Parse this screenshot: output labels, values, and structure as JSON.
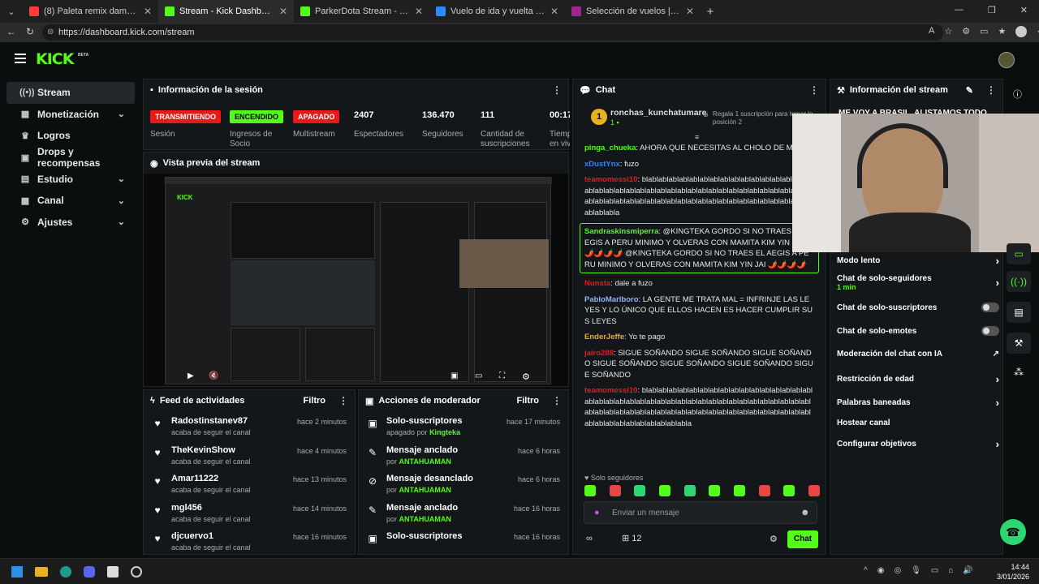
{
  "browser": {
    "tabs": [
      {
        "title": "(8) Paleta remix dame paleta palet",
        "color": "#ff3b3b"
      },
      {
        "title": "Stream - Kick Dashboard",
        "color": "#53fc18",
        "active": true
      },
      {
        "title": "ParkerDota Stream - Watch Live o",
        "color": "#53fc18"
      },
      {
        "title": "Vuelo de ida y vuelta a Fortaleza |",
        "color": "#2a8bff"
      },
      {
        "title": "Selección de vuelos | LATAM Airlin",
        "color": "#a0258f"
      }
    ],
    "url": "https://dashboard.kick.com/stream"
  },
  "header": {
    "logo": "KICK",
    "logo_beta": "BETA"
  },
  "sidebar": {
    "items": [
      {
        "label": "Stream",
        "icon": "broadcast-icon",
        "active": true
      },
      {
        "label": "Monetización",
        "icon": "money-icon",
        "chevron": true
      },
      {
        "label": "Logros",
        "icon": "trophy-icon"
      },
      {
        "label": "Drops y recompensas",
        "icon": "gift-icon"
      },
      {
        "label": "Estudio",
        "icon": "studio-icon",
        "chevron": true
      },
      {
        "label": "Canal",
        "icon": "user-icon",
        "chevron": true
      },
      {
        "label": "Ajustes",
        "icon": "gear-icon",
        "chevron": true
      }
    ]
  },
  "session": {
    "title": "Información de la sesión",
    "stats": [
      {
        "badge": "TRANSMITIENDO",
        "badge_color": "#e91916",
        "label": "Sesión"
      },
      {
        "badge": "ENCENDIDO",
        "badge_color": "#53fc18",
        "label": "Ingresos de Socio"
      },
      {
        "badge": "APAGADO",
        "badge_color": "#e91916",
        "label": "Multistream"
      },
      {
        "value": "2407",
        "label": "Espectadores"
      },
      {
        "value": "136.470",
        "label": "Seguidores"
      },
      {
        "value": "111",
        "label": "Cantidad de suscripciones"
      },
      {
        "value": "00:17",
        "label": "Tiempo en vivo"
      }
    ]
  },
  "preview": {
    "title": "Vista previa del stream"
  },
  "feed": {
    "title": "Feed de actividades",
    "filter": "Filtro",
    "rows": [
      {
        "user": "Radostinstanev87",
        "action": "acaba de seguir el canal",
        "time": "hace 2 minutos"
      },
      {
        "user": "TheKevinShow",
        "action": "acaba de seguir el canal",
        "time": "hace 4 minutos"
      },
      {
        "user": "Amar11222",
        "action": "acaba de seguir el canal",
        "time": "hace 13 minutos"
      },
      {
        "user": "mgl456",
        "action": "acaba de seguir el canal",
        "time": "hace 14 minutos"
      },
      {
        "user": "djcuervo1",
        "action": "acaba de seguir el canal",
        "time": "hace 16 minutos"
      }
    ]
  },
  "modactions": {
    "title": "Acciones de moderador",
    "filter": "Filtro",
    "rows": [
      {
        "action": "Solo-suscriptores",
        "sub_prefix": "apagado por",
        "by": "Kingteka",
        "time": "hace 17 minutos",
        "icon": "gift-icon"
      },
      {
        "action": "Mensaje anclado",
        "sub_prefix": "por",
        "by": "ANTAHUAMAN",
        "time": "hace 6 horas",
        "icon": "pin-icon"
      },
      {
        "action": "Mensaje desanclado",
        "sub_prefix": "por",
        "by": "ANTAHUAMAN",
        "time": "hace 6 horas",
        "icon": "unpin-icon"
      },
      {
        "action": "Mensaje anclado",
        "sub_prefix": "por",
        "by": "ANTAHUAMAN",
        "time": "hace 16 horas",
        "icon": "pin-icon"
      },
      {
        "action": "Solo-suscriptores",
        "sub_prefix": "",
        "by": "",
        "time": "hace 16 horas",
        "icon": "gift-icon"
      }
    ]
  },
  "chat": {
    "title": "Chat",
    "pinned_user": "ronchas_kunchatumare",
    "pinned_level": "1",
    "gift_text": "Regala 1 suscripción para tomar la posición 2",
    "messages": [
      {
        "user": "pinga_chueka",
        "color": "#53fc18",
        "text": "AHORA QUE NECESITAS AL CHOLO DE MRD"
      },
      {
        "user": "xDustYnx",
        "color": "#3b82f6",
        "text": "fuzo"
      },
      {
        "user": "teamomessi10",
        "color": "#e91916",
        "text": "blablablablablablablablablablablablablablablablablablablablablablablablablablablablablablablablablablablablablablablablablablablablablablablablablablablablablablablablablablablablablablablabla"
      },
      {
        "user": "Sandraskinsmiperra",
        "color": "#53fc18",
        "highlight": true,
        "text": "@KINGTEKA GORDO SI NO TRAES EL AEGIS A PERU MINIMO Y OLVERAS CON MAMITA KIM YIN JAI 🌶️🌶️🌶️🌶️ @KINGTEKA GORDO SI NO TRAES EL AEGIS A PERU MINIMO Y OLVERAS CON MAMITA KIM YIN JAI 🌶️🌶️🌶️🌶️"
      },
      {
        "user": "Nunsta",
        "color": "#e91916",
        "text": "dale a fuzo"
      },
      {
        "user": "PabloMarlboro",
        "color": "#8fb4ff",
        "text": "LA GENTE ME TRATA MAL = INFRINJE LAS LEYES Y LO ÚNICO QUE ELLOS HACEN ES HACER CUMPLIR SUS LEYES"
      },
      {
        "user": "EnderJeffe",
        "color": "#f5a623",
        "text": "Yo te pago"
      },
      {
        "user": "jairo288",
        "color": "#e91916",
        "text": "SIGUE SOÑANDO SIGUE SOÑANDO SIGUE SOÑANDO SIGUE SOÑANDO SIGUE SOÑANDO SIGUE SOÑANDO SIGUE SOÑANDO"
      },
      {
        "user": "teamomessi10",
        "color": "#e91916",
        "text": "blablablablablablablablablablablablablablablablablablablablablablablablablablablablablablablablablablablablablablablablablablablablablablablablablablablablablablablablablablablablablablablablablablablablablablabla"
      }
    ],
    "mode": "Solo seguidores",
    "input_placeholder": "Enviar un mensaje",
    "viewers_label": "12",
    "send_label": "Chat"
  },
  "streaminfo": {
    "title": "Información del stream",
    "stream_title": "ME VOY A BRASIL, ALISTAMOS TODO",
    "rows": [
      {
        "label": "Modo lento",
        "type": "chevron"
      },
      {
        "label": "Chat de solo-seguidores",
        "sub": "1 min",
        "type": "chevron"
      },
      {
        "label": "Chat de solo-suscriptores",
        "type": "toggle"
      },
      {
        "label": "Chat de solo-emotes",
        "type": "toggle"
      },
      {
        "label": "Moderación del chat con IA",
        "type": "external"
      },
      {
        "label": "Restricción de edad",
        "type": "chevron"
      },
      {
        "label": "Palabras baneadas",
        "type": "chevron"
      },
      {
        "label": "Hostear canal",
        "type": "none"
      },
      {
        "label": "Configurar objetivos",
        "type": "chevron"
      }
    ]
  },
  "taskbar": {
    "time": "14:44",
    "date": "3/01/2026"
  },
  "colors": {
    "accent": "#53fc18",
    "danger": "#e91916",
    "panel": "#141719"
  }
}
